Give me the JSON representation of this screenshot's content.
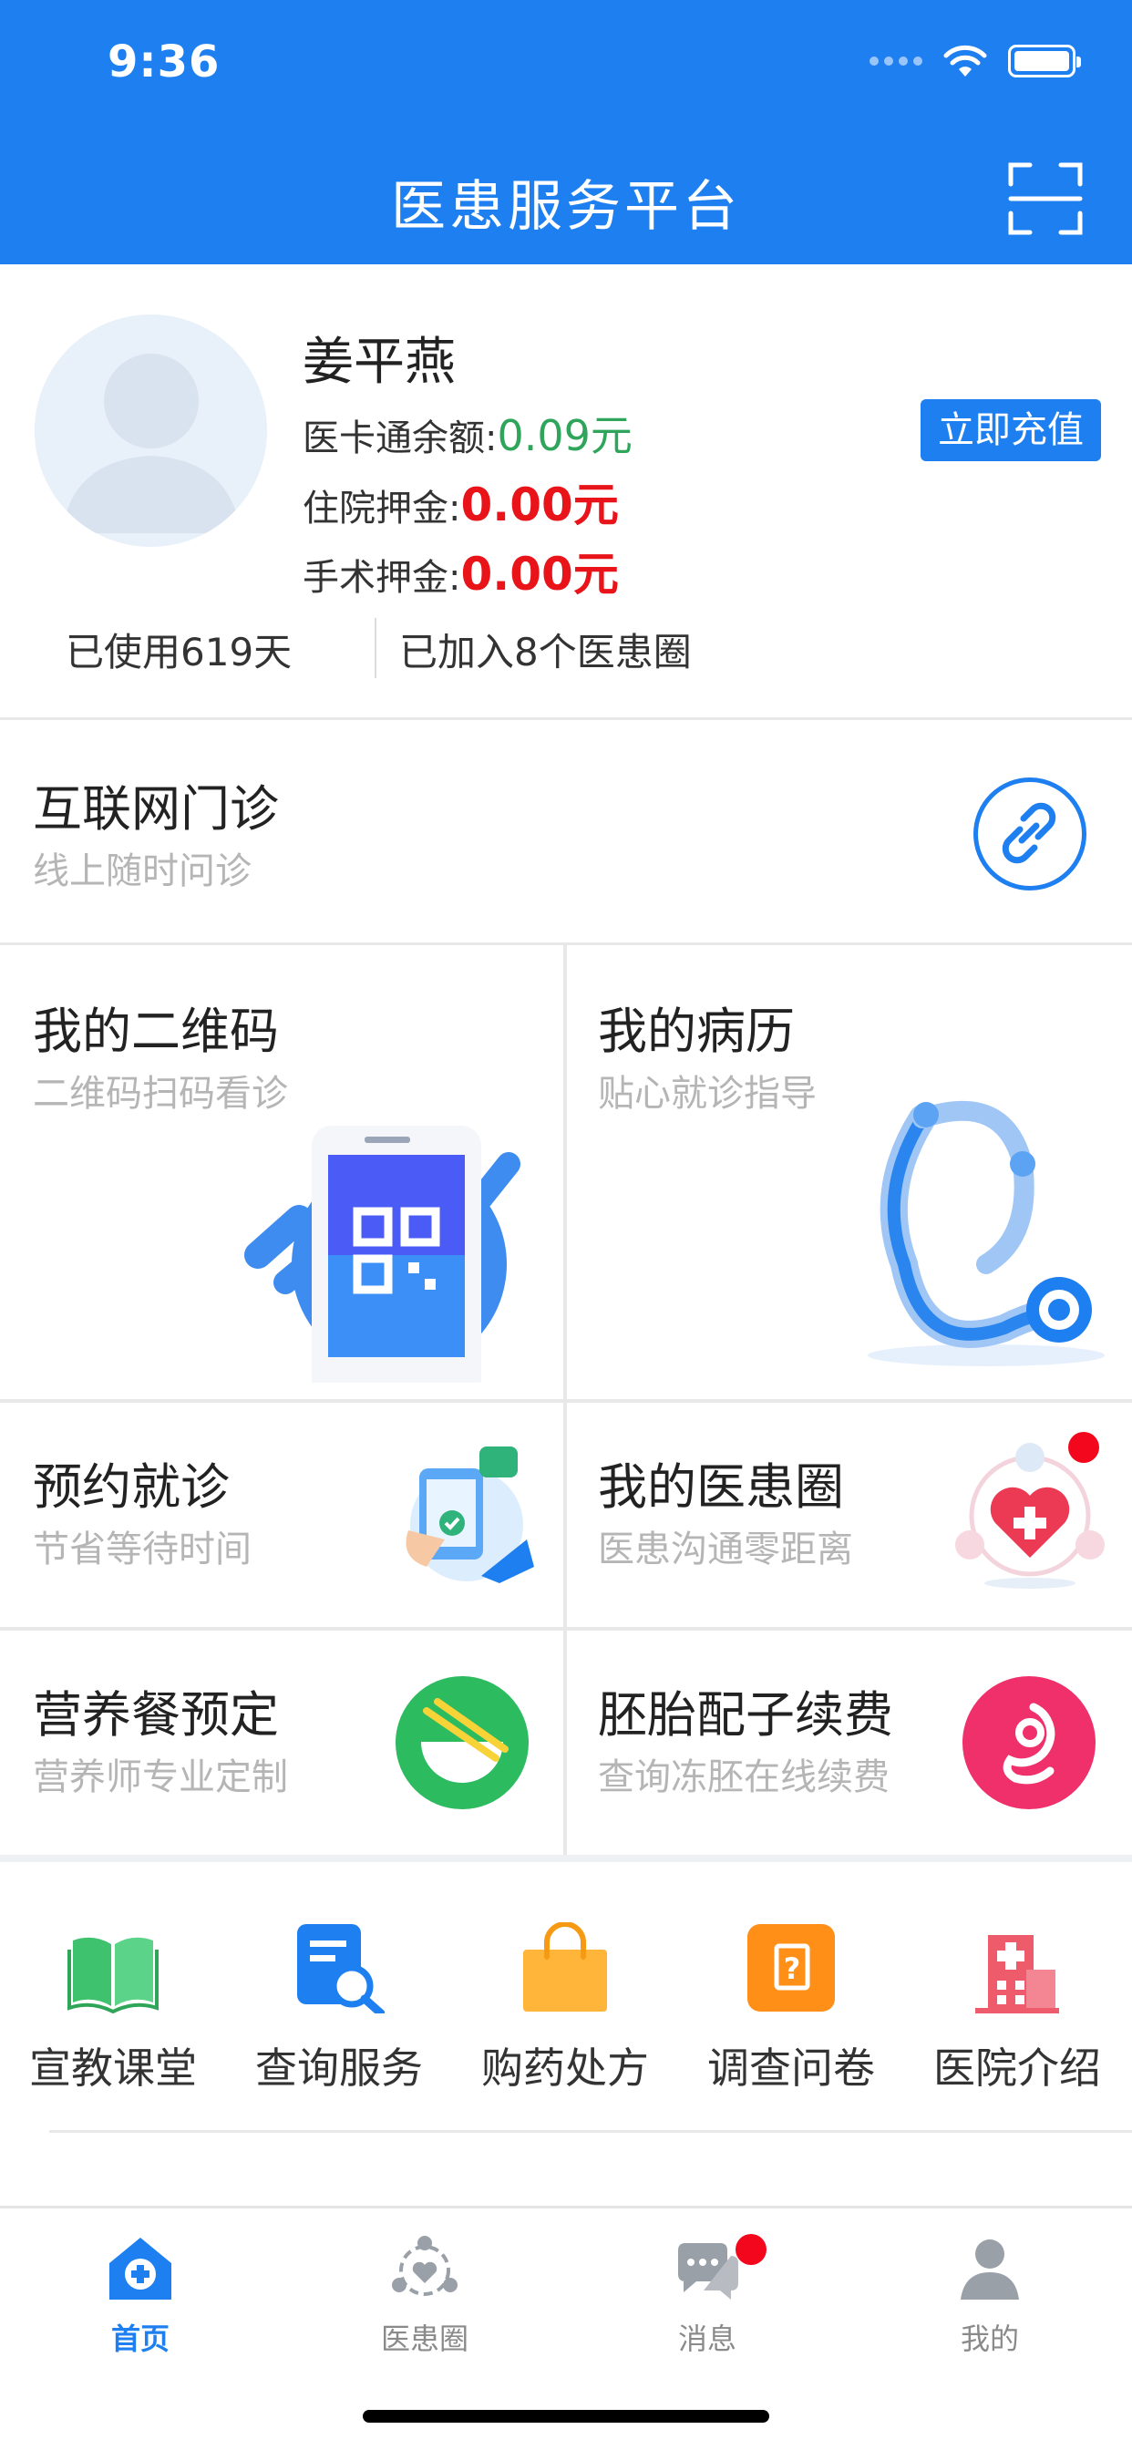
{
  "status_bar": {
    "time": "9:36"
  },
  "header": {
    "title": "医患服务平台",
    "scan_icon": "scan-icon"
  },
  "profile": {
    "name": "姜平燕",
    "card_balance_label": "医卡通余额:",
    "card_balance_value": "0.09元",
    "hospital_deposit_label": "住院押金:",
    "hospital_deposit_value": "0.00元",
    "surgery_deposit_label": "手术押金:",
    "surgery_deposit_value": "0.00元",
    "recharge_label": "立即充值",
    "days_used": "已使用619天",
    "circles_joined": "已加入8个医患圈"
  },
  "clinic": {
    "title": "互联网门诊",
    "subtitle": "线上随时问诊",
    "icon": "link-icon"
  },
  "cards": [
    {
      "title": "我的二维码",
      "subtitle": "二维码扫码看诊",
      "icon": "qr-phone-icon"
    },
    {
      "title": "我的病历",
      "subtitle": "贴心就诊指导",
      "icon": "stethoscope-icon"
    },
    {
      "title": "预约就诊",
      "subtitle": "节省等待时间",
      "icon": "appointment-icon"
    },
    {
      "title": "我的医患圈",
      "subtitle": "医患沟通零距离",
      "icon": "heart-circle-icon"
    },
    {
      "title": "营养餐预定",
      "subtitle": "营养师专业定制",
      "icon": "bowl-icon"
    },
    {
      "title": "胚胎配子续费",
      "subtitle": "查询冻胚在线续费",
      "icon": "embryo-icon"
    }
  ],
  "quick_links": [
    {
      "label": "宣教课堂",
      "icon": "book-icon",
      "color": "#3ec26d"
    },
    {
      "label": "查询服务",
      "icon": "search-doc-icon",
      "color": "#1e7ff0"
    },
    {
      "label": "购药处方",
      "icon": "shopping-bag-icon",
      "color": "#ffa826"
    },
    {
      "label": "调查问卷",
      "icon": "questionnaire-icon",
      "color": "#ff8f16"
    },
    {
      "label": "医院介绍",
      "icon": "hospital-icon",
      "color": "#ee5b6b"
    }
  ],
  "tabs": [
    {
      "label": "首页",
      "icon": "home-icon",
      "active": true
    },
    {
      "label": "医患圈",
      "icon": "circle-icon",
      "active": false
    },
    {
      "label": "消息",
      "icon": "chat-icon",
      "active": false
    },
    {
      "label": "我的",
      "icon": "user-icon",
      "active": false
    }
  ],
  "colors": {
    "primary": "#1e7ff0",
    "green": "#2fa45b",
    "red": "#e8141a",
    "badge": "#f3071d"
  }
}
